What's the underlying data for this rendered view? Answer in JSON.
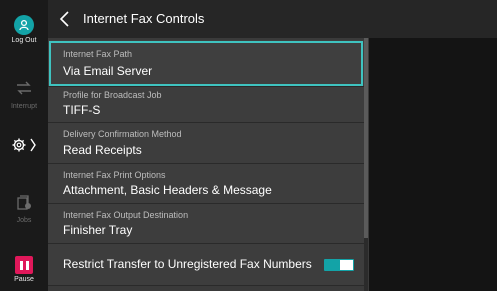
{
  "rail": {
    "logout_label": "Log Out",
    "interrupt_label": "Interrupt",
    "jobs_label": "Jobs",
    "pause_label": "Pause"
  },
  "header": {
    "title": "Internet Fax Controls"
  },
  "items": [
    {
      "label": "Internet Fax Path",
      "value": "Via Email Server"
    },
    {
      "label": "Profile for Broadcast Job",
      "value": "TIFF-S"
    },
    {
      "label": "Delivery Confirmation Method",
      "value": "Read Receipts"
    },
    {
      "label": "Internet Fax Print Options",
      "value": "Attachment, Basic Headers & Message"
    },
    {
      "label": "Internet Fax Output Destination",
      "value": "Finisher Tray"
    }
  ],
  "toggle_item": {
    "label": "Restrict Transfer to Unregistered Fax Numbers",
    "state": "on"
  },
  "colors": {
    "accent": "#13a3a7",
    "selection_outline": "#3fc3c0",
    "pause": "#e0185a"
  }
}
